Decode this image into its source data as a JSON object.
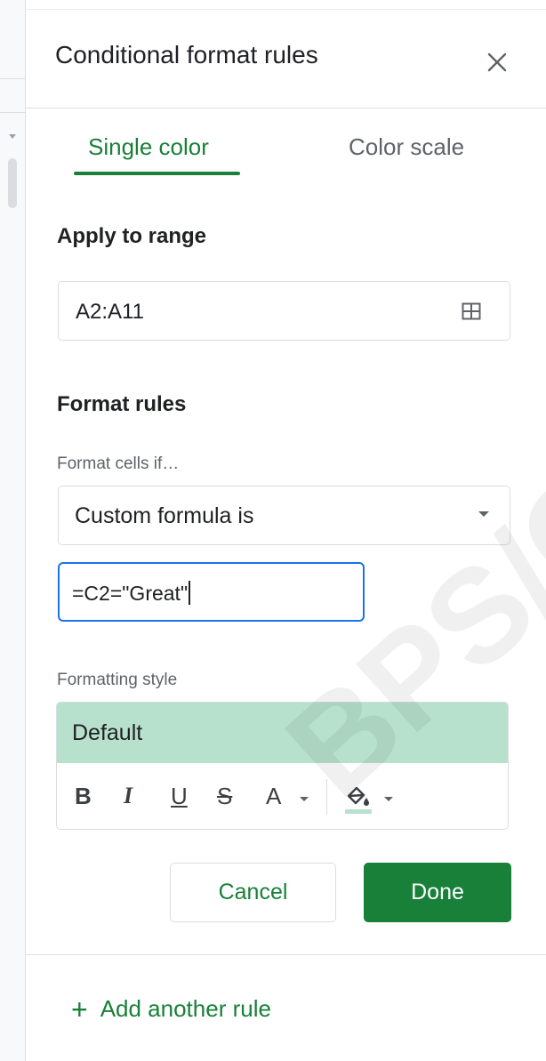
{
  "panel": {
    "title": "Conditional format rules",
    "close_icon": "close-icon"
  },
  "tabs": [
    {
      "label": "Single color",
      "active": true
    },
    {
      "label": "Color scale",
      "active": false
    }
  ],
  "apply_to_range": {
    "label": "Apply to range",
    "value": "A2:A11",
    "icon": "grid-icon"
  },
  "format_rules": {
    "label": "Format rules",
    "condition_label": "Format cells if…",
    "condition_value": "Custom formula is",
    "formula_value": "=C2=\"Great\""
  },
  "formatting_style": {
    "label": "Formatting style",
    "preview_text": "Default",
    "preview_color": "#b7e1cd",
    "toolbar": {
      "bold": "B",
      "italic": "I",
      "underline": "U",
      "strikethrough": "S",
      "text_color": "A",
      "fill_icon": "fill-color-icon"
    }
  },
  "actions": {
    "cancel": "Cancel",
    "done": "Done"
  },
  "add_rule": {
    "plus": "+",
    "label": "Add another rule"
  },
  "watermark": "BPS/C",
  "colors": {
    "accent_green": "#188038",
    "focus_blue": "#1a73e8"
  }
}
